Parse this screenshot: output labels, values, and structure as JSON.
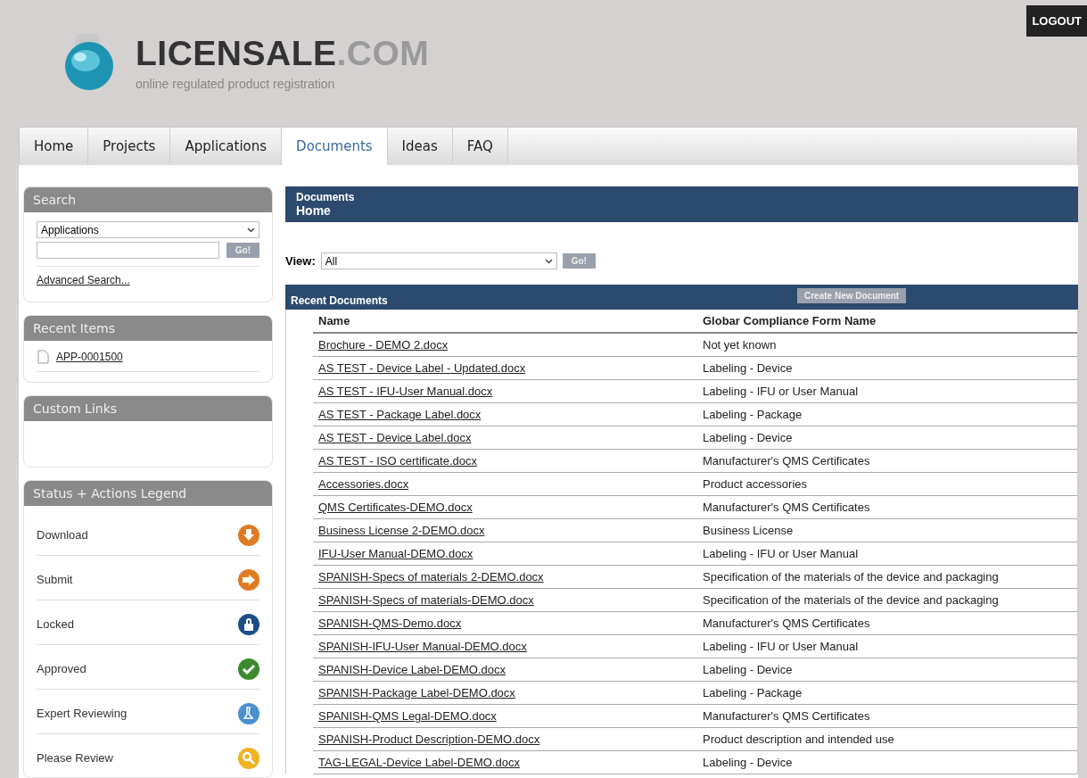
{
  "header": {
    "logo_name": "LICENSALE",
    "logo_suffix": ".COM",
    "tagline": "online regulated product registration",
    "logout": "LOGOUT"
  },
  "tabs": [
    {
      "label": "Home",
      "selected": false
    },
    {
      "label": "Projects",
      "selected": false
    },
    {
      "label": "Applications",
      "selected": false
    },
    {
      "label": "Documents",
      "selected": true
    },
    {
      "label": "Ideas",
      "selected": false
    },
    {
      "label": "FAQ",
      "selected": false
    }
  ],
  "sidebar": {
    "search": {
      "title": "Search",
      "select_value": "Applications",
      "go": "Go!",
      "advanced": "Advanced Search..."
    },
    "recent_items": {
      "title": "Recent Items",
      "items": [
        "APP-0001500"
      ]
    },
    "custom_links": {
      "title": "Custom Links"
    },
    "legend": {
      "title": "Status + Actions Legend",
      "items": [
        {
          "label": "Download",
          "kind": "download",
          "color": "#e07b24"
        },
        {
          "label": "Submit",
          "kind": "submit",
          "color": "#e07b24"
        },
        {
          "label": "Locked",
          "kind": "locked",
          "color": "#1d4f86"
        },
        {
          "label": "Approved",
          "kind": "approved",
          "color": "#3c8a2e"
        },
        {
          "label": "Expert Reviewing",
          "kind": "expert",
          "color": "#4a8fd0"
        },
        {
          "label": "Please Review",
          "kind": "review",
          "color": "#f0b323"
        }
      ]
    }
  },
  "main": {
    "breadcrumb": [
      "Documents",
      "Home"
    ],
    "view": {
      "label": "View:",
      "value": "All",
      "go": "Go!"
    },
    "table": {
      "title": "Recent Documents",
      "create_button": "Create New Document",
      "columns": [
        "Name",
        "Globar Compliance Form Name"
      ],
      "rows": [
        [
          "Brochure - DEMO 2.docx",
          "Not yet known"
        ],
        [
          "AS TEST - Device Label - Updated.docx",
          "Labeling - Device"
        ],
        [
          "AS TEST - IFU-User Manual.docx",
          "Labeling - IFU or User Manual"
        ],
        [
          "AS TEST - Package Label.docx",
          "Labeling - Package"
        ],
        [
          "AS TEST - Device Label.docx",
          "Labeling - Device"
        ],
        [
          "AS TEST - ISO certificate.docx",
          "Manufacturer's QMS Certificates"
        ],
        [
          "Accessories.docx",
          "Product accessories"
        ],
        [
          "QMS Certificates-DEMO.docx",
          "Manufacturer's QMS Certificates"
        ],
        [
          "Business License 2-DEMO.docx",
          "Business License"
        ],
        [
          "IFU-User Manual-DEMO.docx",
          "Labeling - IFU or User Manual"
        ],
        [
          "SPANISH-Specs of materials 2-DEMO.docx",
          "Specification of the materials of the device and packaging"
        ],
        [
          "SPANISH-Specs of materials-DEMO.docx",
          "Specification of the materials of the device and packaging"
        ],
        [
          "SPANISH-QMS-Demo.docx",
          "Manufacturer's QMS Certificates"
        ],
        [
          "SPANISH-IFU-User Manual-DEMO.docx",
          "Labeling - IFU or User Manual"
        ],
        [
          "SPANISH-Device Label-DEMO.docx",
          "Labeling - Device"
        ],
        [
          "SPANISH-Package Label-DEMO.docx",
          "Labeling - Package"
        ],
        [
          "SPANISH-QMS Legal-DEMO.docx",
          "Manufacturer's QMS Certificates"
        ],
        [
          "SPANISH-Product Description-DEMO.docx",
          "Product description and intended use"
        ],
        [
          "TAG-LEGAL-Device Label-DEMO.docx",
          "Labeling - Device"
        ]
      ]
    }
  }
}
